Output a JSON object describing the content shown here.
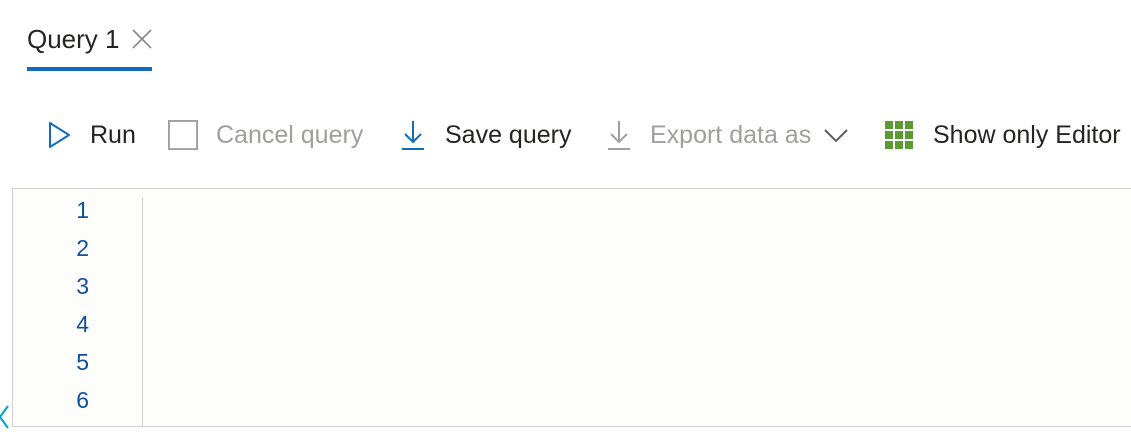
{
  "tab": {
    "label": "Query 1",
    "close_icon": "close-icon",
    "accent": "#0f6cbd"
  },
  "toolbar": {
    "run": {
      "label": "Run",
      "icon": "play-icon",
      "color": "#0f6cbd"
    },
    "cancel": {
      "label": "Cancel query",
      "icon": "stop-icon",
      "disabled": true
    },
    "save": {
      "label": "Save query",
      "icon": "download-icon",
      "color": "#0f6cbd"
    },
    "export": {
      "label": "Export data as",
      "icon": "download-icon",
      "disabled": true,
      "dropdown_icon": "chevron-down-icon"
    },
    "show_editor": {
      "label": "Show only Editor",
      "icon": "grid-icon",
      "color": "#5b9b32"
    }
  },
  "editor": {
    "line_numbers": [
      "1",
      "2",
      "3",
      "4",
      "5",
      "6"
    ],
    "content": "",
    "line_number_color": "#0f4f9e"
  }
}
